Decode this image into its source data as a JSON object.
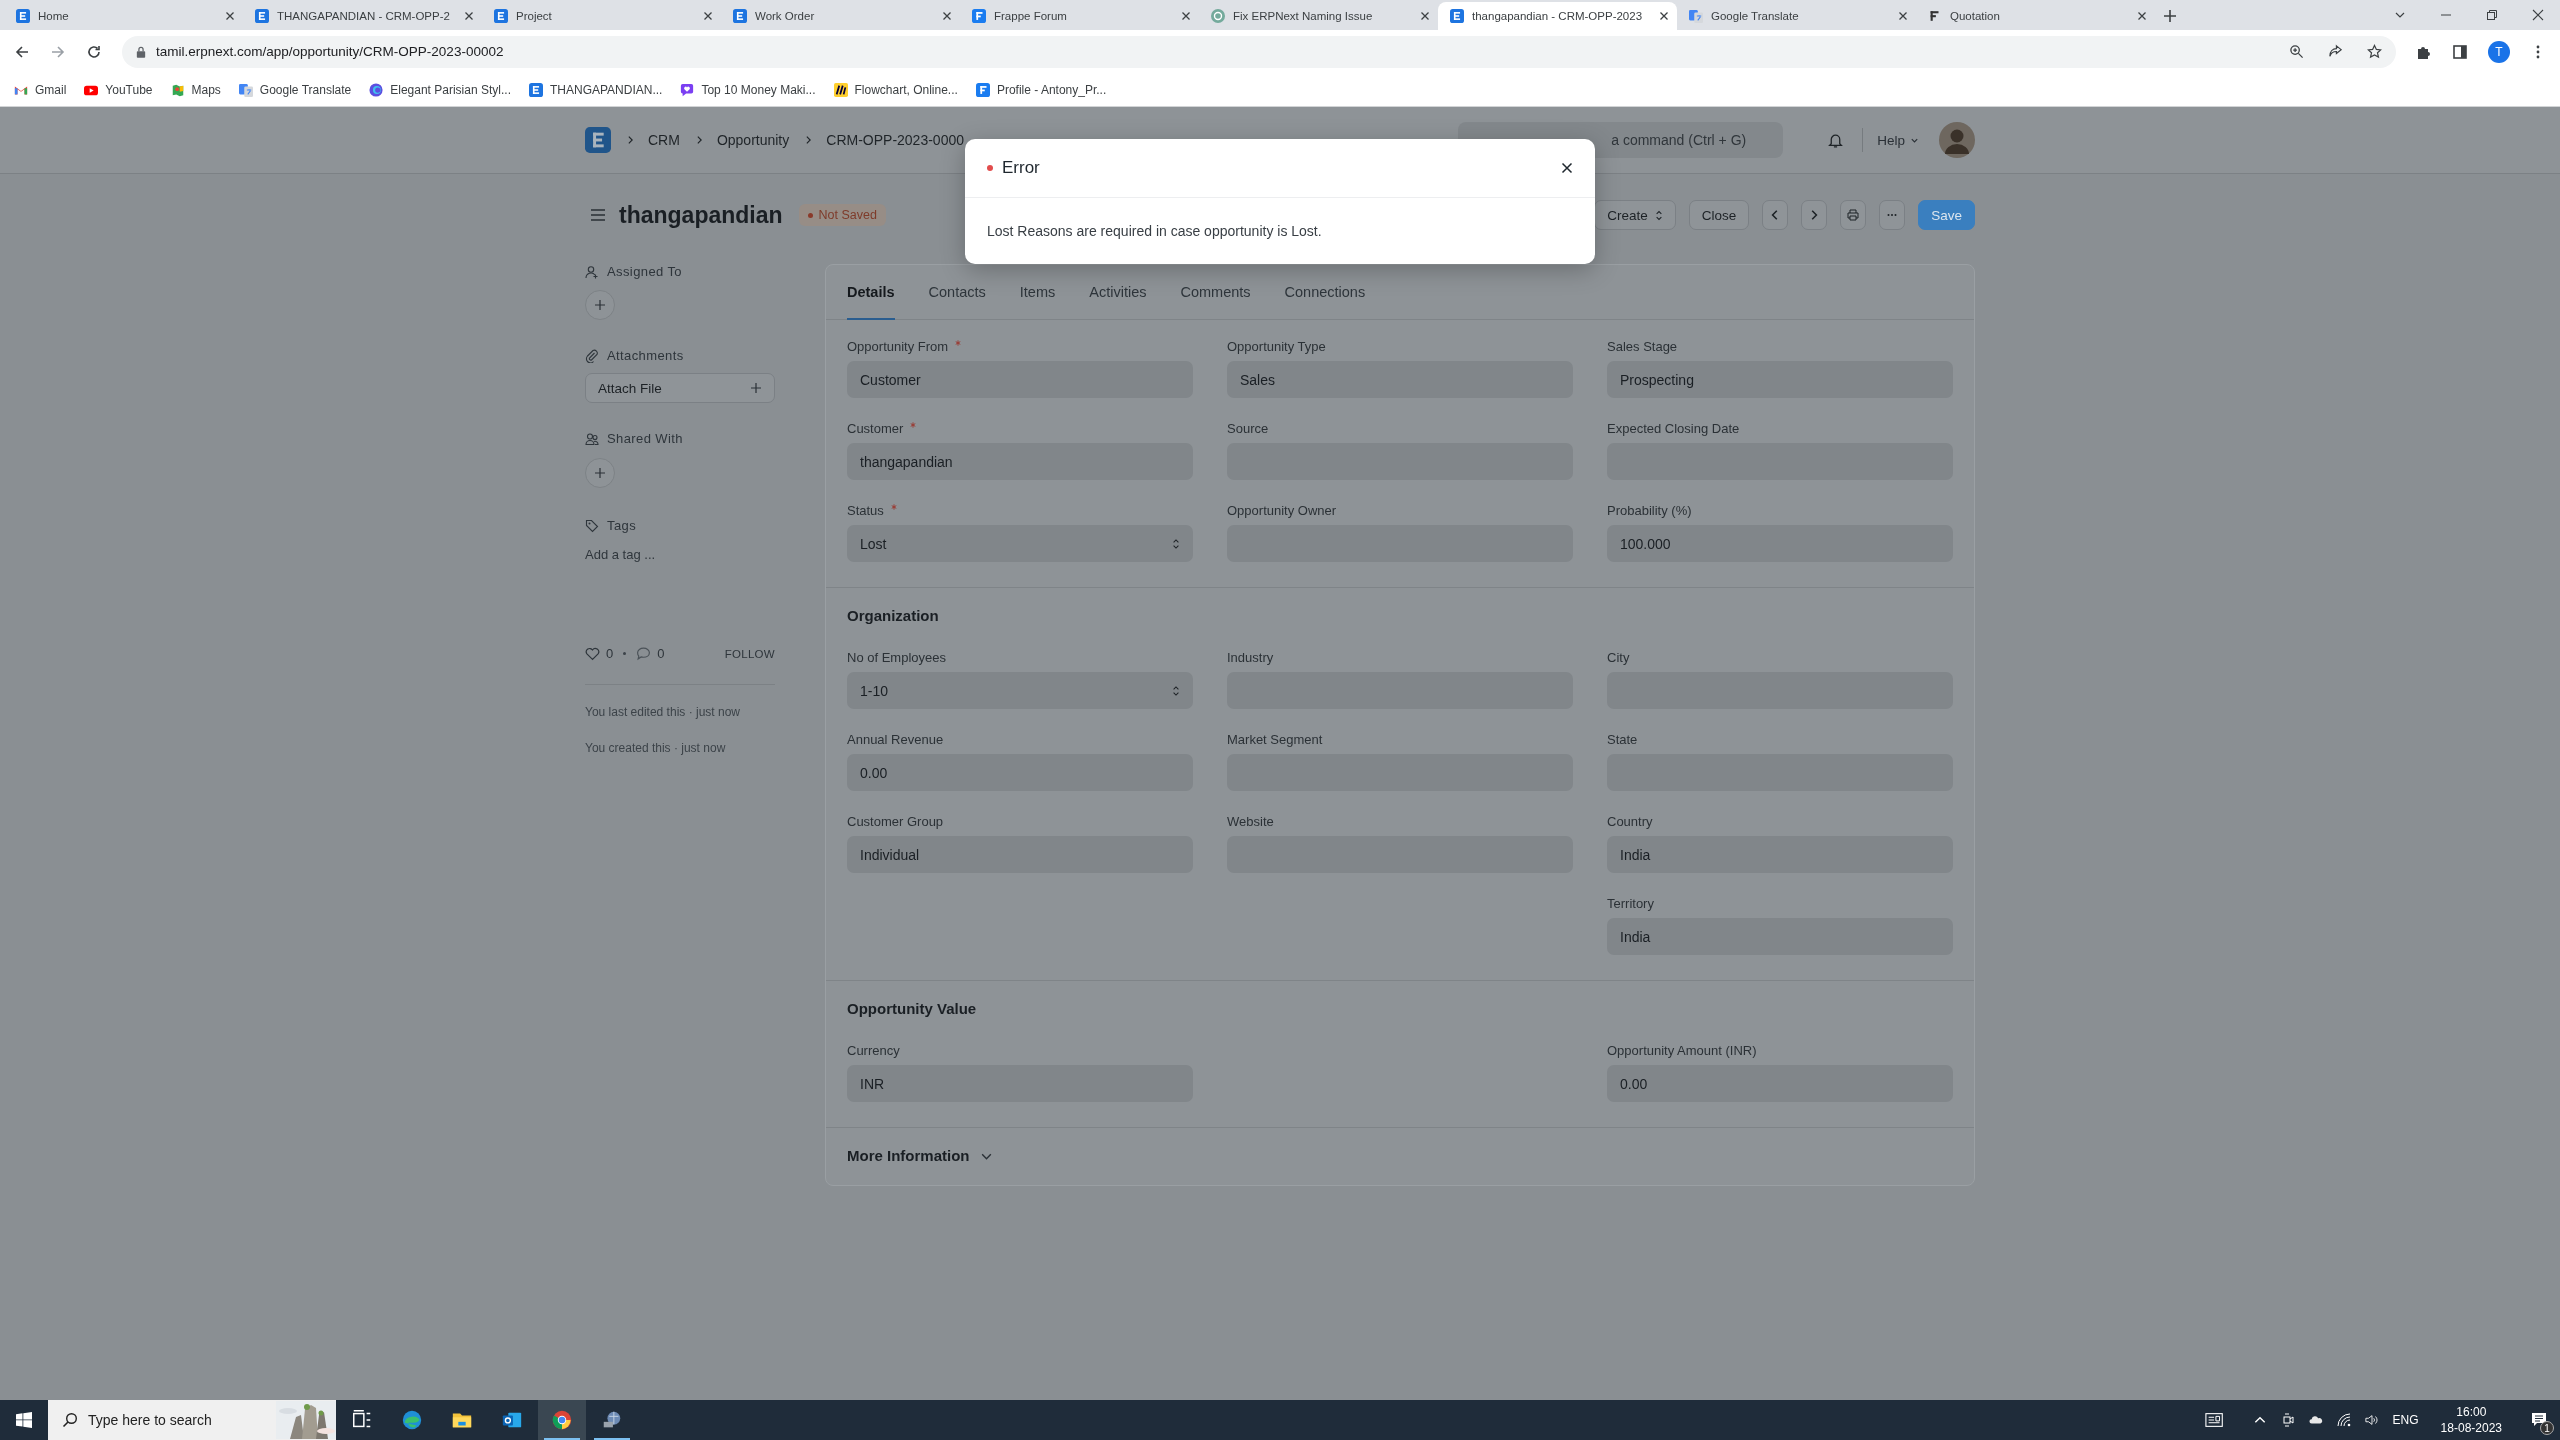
{
  "browser": {
    "tabs": [
      {
        "title": "Home",
        "kind": "erpnext",
        "selected": false
      },
      {
        "title": "THANGAPANDIAN - CRM-OPP-2",
        "kind": "erpnext",
        "selected": false
      },
      {
        "title": "Project",
        "kind": "erpnext",
        "selected": false
      },
      {
        "title": "Work Order",
        "kind": "erpnext",
        "selected": false
      },
      {
        "title": "Frappe Forum",
        "kind": "frappe",
        "selected": false
      },
      {
        "title": "Fix ERPNext Naming Issue",
        "kind": "knot",
        "selected": false
      },
      {
        "title": "thangapandian - CRM-OPP-2023",
        "kind": "erpnext",
        "selected": true
      },
      {
        "title": "Google Translate",
        "kind": "translate",
        "selected": false
      },
      {
        "title": "Quotation",
        "kind": "frappe-dark",
        "selected": false
      }
    ],
    "url": "tamil.erpnext.com/app/opportunity/CRM-OPP-2023-00002",
    "profile": "T",
    "bookmarks": [
      {
        "label": "Gmail",
        "kind": "gmail"
      },
      {
        "label": "YouTube",
        "kind": "youtube"
      },
      {
        "label": "Maps",
        "kind": "maps"
      },
      {
        "label": "Google Translate",
        "kind": "translate"
      },
      {
        "label": "Elegant Parisian Styl...",
        "kind": "circle"
      },
      {
        "label": "THANGAPANDIAN...",
        "kind": "erpnext"
      },
      {
        "label": "Top 10 Money Maki...",
        "kind": "chat"
      },
      {
        "label": "Flowchart, Online...",
        "kind": "flowchart"
      },
      {
        "label": "Profile - Antony_Pr...",
        "kind": "frappe"
      }
    ]
  },
  "navbar": {
    "breadcrumbs": [
      "CRM",
      "Opportunity",
      "CRM-OPP-2023-0000"
    ],
    "search": {
      "placeholder": "a command (Ctrl + G)"
    },
    "help": "Help"
  },
  "document": {
    "title": "thangapandian",
    "status": "Not Saved",
    "actions": [
      {
        "label": "Create",
        "kind": "dropdown"
      },
      {
        "label": "Close",
        "kind": "plain"
      },
      {
        "kind": "prev"
      },
      {
        "kind": "next"
      },
      {
        "kind": "print"
      },
      {
        "kind": "more"
      },
      {
        "label": "Save",
        "kind": "primary"
      }
    ]
  },
  "sidebar": {
    "assigned_to": "Assigned To",
    "attachments": "Attachments",
    "attach_file": "Attach File",
    "shared_with": "Shared With",
    "tags": "Tags",
    "tag_input": {
      "placeholder": "Add a tag ..."
    },
    "likes": "0",
    "comments": "0",
    "follow": "FOLLOW",
    "activity": [
      "You last edited this · just now",
      "You created this · just now"
    ]
  },
  "form": {
    "tabs": [
      {
        "label": "Details",
        "selected": true
      },
      {
        "label": "Contacts",
        "selected": false
      },
      {
        "label": "Items",
        "selected": false
      },
      {
        "label": "Activities",
        "selected": false
      },
      {
        "label": "Comments",
        "selected": false
      },
      {
        "label": "Connections",
        "selected": false
      }
    ],
    "sections": [
      {
        "columns": [
          [
            {
              "label": "Opportunity From",
              "required": true,
              "kind": "data",
              "value": "Customer"
            },
            {
              "label": "Customer",
              "required": true,
              "kind": "data",
              "value": "thangapandian"
            },
            {
              "label": "Status",
              "required": true,
              "kind": "select",
              "value": "Lost"
            }
          ],
          [
            {
              "label": "Opportunity Type",
              "required": false,
              "kind": "data",
              "value": "Sales"
            },
            {
              "label": "Source",
              "required": false,
              "kind": "data"
            },
            {
              "label": "Opportunity Owner",
              "required": false,
              "kind": "data"
            }
          ],
          [
            {
              "label": "Sales Stage",
              "required": false,
              "kind": "data",
              "value": "Prospecting"
            },
            {
              "label": "Expected Closing Date",
              "required": false,
              "kind": "data"
            },
            {
              "label": "Probability (%)",
              "required": false,
              "kind": "data",
              "value": "100.000"
            }
          ]
        ]
      },
      {
        "title": "Organization",
        "columns": [
          [
            {
              "label": "No of Employees",
              "required": false,
              "kind": "select",
              "value": "1-10"
            },
            {
              "label": "Annual Revenue",
              "required": false,
              "kind": "data",
              "value": "0.00"
            },
            {
              "label": "Customer Group",
              "required": false,
              "kind": "data",
              "value": "Individual"
            }
          ],
          [
            {
              "label": "Industry",
              "required": false,
              "kind": "data"
            },
            {
              "label": "Market Segment",
              "required": false,
              "kind": "data"
            },
            {
              "label": "Website",
              "required": false,
              "kind": "data"
            }
          ],
          [
            {
              "label": "City",
              "required": false,
              "kind": "data"
            },
            {
              "label": "State",
              "required": false,
              "kind": "data"
            },
            {
              "label": "Country",
              "required": false,
              "kind": "data",
              "value": "India"
            },
            {
              "label": "Territory",
              "required": false,
              "kind": "data",
              "value": "India"
            }
          ]
        ]
      },
      {
        "title": "Opportunity Value",
        "columns": [
          [
            {
              "label": "Currency",
              "required": false,
              "kind": "data",
              "value": "INR"
            }
          ],
          [],
          [
            {
              "label": "Opportunity Amount (INR)",
              "required": false,
              "kind": "data",
              "value": "0.00"
            }
          ]
        ]
      },
      {
        "title": "More Information",
        "expanded": false
      }
    ]
  },
  "dialog": {
    "title": "Error",
    "message": "Lost Reasons are required in case opportunity is Lost."
  },
  "taskbar": {
    "search": {
      "placeholder": "Type here to search"
    },
    "apps": [
      {
        "kind": "taskview",
        "running": false,
        "selected": false
      },
      {
        "kind": "edge",
        "running": false,
        "selected": false
      },
      {
        "kind": "explorer",
        "running": false,
        "selected": false
      },
      {
        "kind": "outlook",
        "running": false,
        "selected": false
      },
      {
        "kind": "chrome",
        "running": true,
        "selected": true
      },
      {
        "kind": "globe",
        "running": true,
        "selected": false
      }
    ],
    "language": "ENG",
    "time": "16:00",
    "date": "18-08-2023",
    "notifications": "1"
  }
}
